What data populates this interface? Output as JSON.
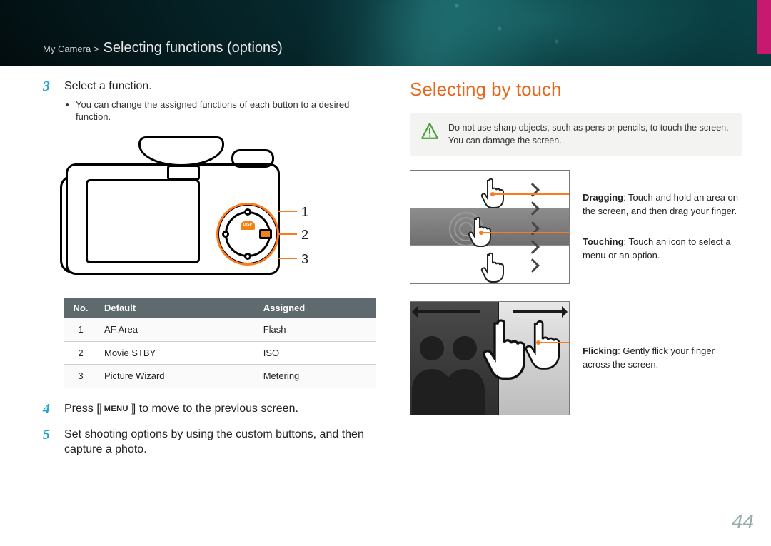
{
  "breadcrumb": {
    "parent": "My Camera",
    "sep": ">",
    "title": "Selecting functions (options)"
  },
  "page_number": "44",
  "left": {
    "steps": {
      "s3_num": "3",
      "s3_text": "Select a function.",
      "s3_bullet": "You can change the assigned functions of each button to a desired function.",
      "callouts": {
        "c1": "1",
        "c2": "2",
        "c3": "3"
      },
      "disp_label": "DISP",
      "table": {
        "headers": {
          "no": "No.",
          "def": "Default",
          "asg": "Assigned"
        },
        "rows": [
          {
            "no": "1",
            "def": "AF Area",
            "asg": "Flash"
          },
          {
            "no": "2",
            "def": "Movie STBY",
            "asg": "ISO"
          },
          {
            "no": "3",
            "def": "Picture Wizard",
            "asg": "Metering"
          }
        ]
      },
      "s4_num": "4",
      "s4_pre": "Press [",
      "s4_menu": "MENU",
      "s4_post": "] to move to the previous screen.",
      "s5_num": "5",
      "s5_text": "Set shooting options by using the custom buttons, and then capture a photo."
    }
  },
  "right": {
    "title": "Selecting by touch",
    "warning": "Do not use sharp objects, such as pens or pencils, to touch the screen. You can damage the screen.",
    "gestures": {
      "drag_label": "Dragging",
      "drag_text": ": Touch and hold an area on the screen, and then drag your finger.",
      "touch_label": "Touching",
      "touch_text": ": Touch an icon to select a menu or an option.",
      "flick_label": "Flicking",
      "flick_text": ": Gently flick your finger across the screen."
    }
  }
}
